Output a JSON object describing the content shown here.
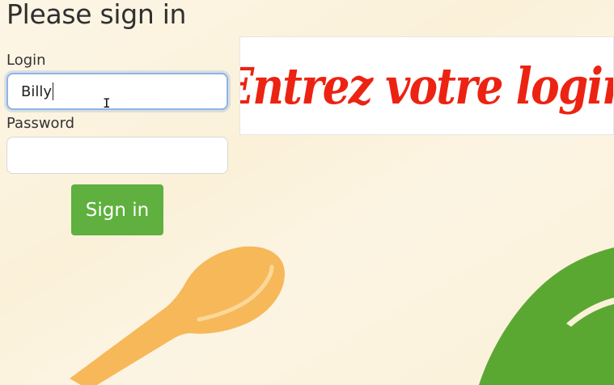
{
  "form": {
    "title": "Please sign in",
    "login_label": "Login",
    "login_value": "Billy",
    "password_label": "Password",
    "password_value": "",
    "submit_label": "Sign in"
  },
  "caption": {
    "text": "Entrez votre login"
  },
  "colors": {
    "background": "#fbf1d9",
    "button": "#5fb03e",
    "caption_text": "#ec2312",
    "spoon": "#f7b85a",
    "leaf": "#5aa832"
  },
  "decorations": {
    "spoon": "spoon-illustration",
    "leaf": "leaf-illustration"
  }
}
